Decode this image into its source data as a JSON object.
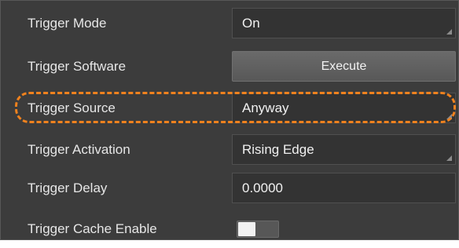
{
  "settings": {
    "trigger_mode": {
      "label": "Trigger Mode",
      "value": "On"
    },
    "trigger_software": {
      "label": "Trigger Software",
      "button_label": "Execute"
    },
    "trigger_source": {
      "label": "Trigger Source",
      "value": "Anyway"
    },
    "trigger_activation": {
      "label": "Trigger Activation",
      "value": "Rising Edge"
    },
    "trigger_delay": {
      "label": "Trigger Delay",
      "value": "0.0000"
    },
    "trigger_cache_enable": {
      "label": "Trigger Cache Enable",
      "enabled": false
    }
  },
  "highlight": {
    "color": "#f0821e",
    "style": "dashed",
    "target": "trigger_source"
  },
  "icons": {
    "dropdown_corner": "dropdown-corner-icon"
  }
}
